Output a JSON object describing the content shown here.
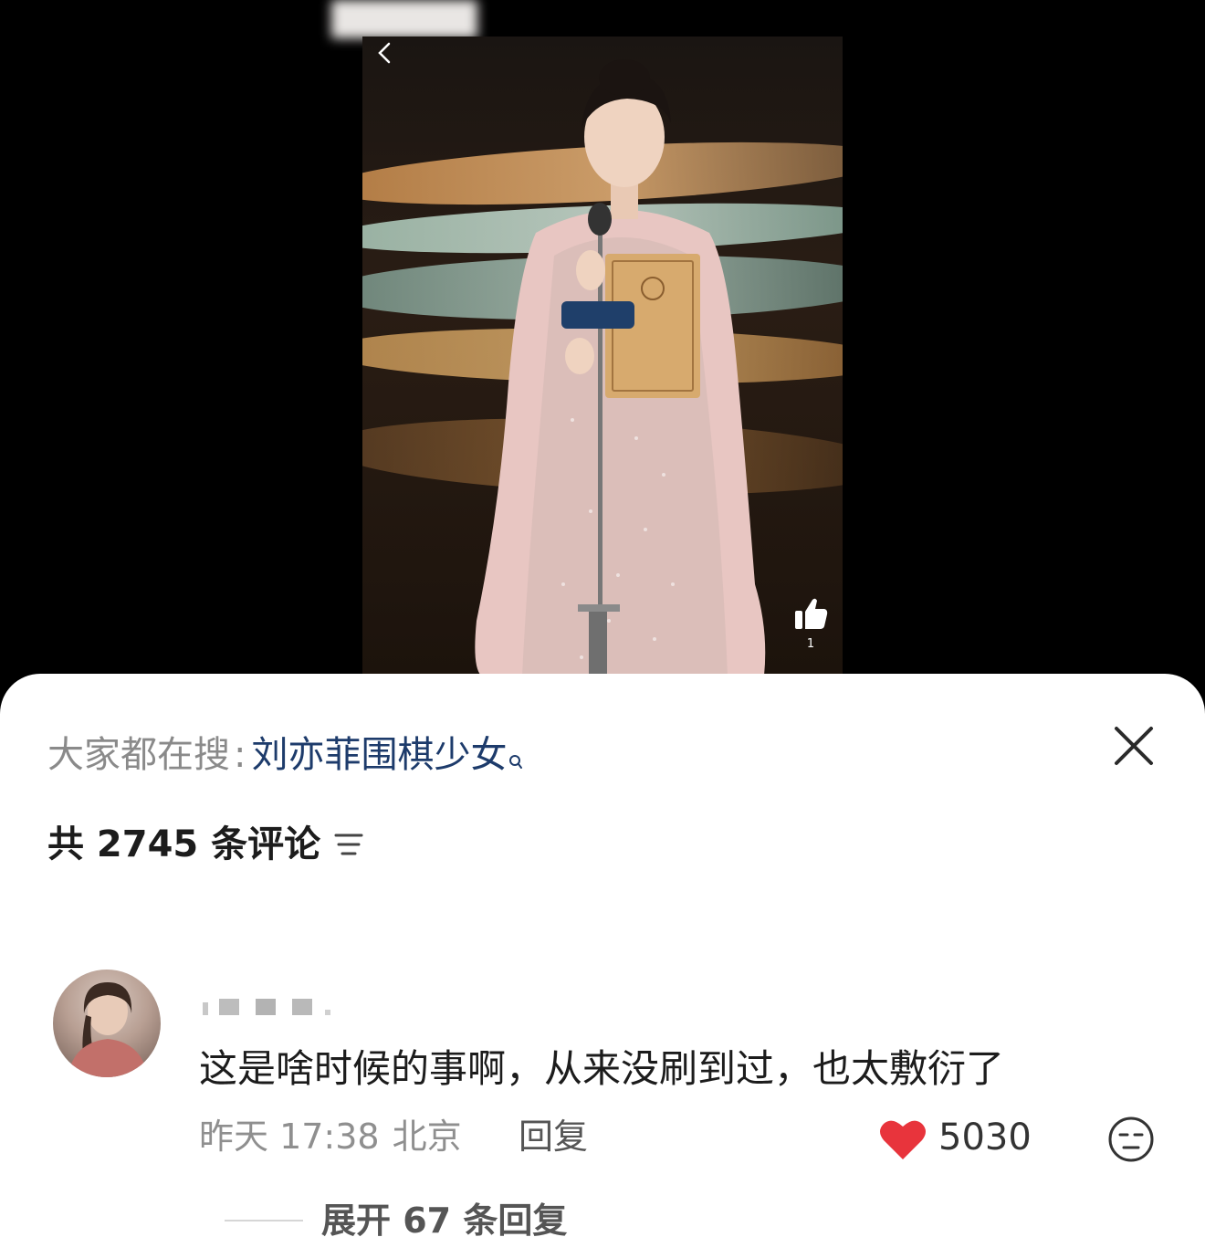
{
  "video": {
    "like_count": "1",
    "icons": {
      "back": "chevron-left-icon",
      "like": "thumbs-up-icon"
    }
  },
  "sheet": {
    "search_prefix": "大家都在搜",
    "search_separator": ":",
    "search_term": "刘亦菲围棋少女",
    "comment_count_text": "共 2745 条评论",
    "icons": {
      "close": "close-icon",
      "sort": "sort-lines-icon",
      "search": "search-icon"
    },
    "comment": {
      "text": "这是啥时候的事啊，从来没刷到过，也太敷衍了",
      "date": "昨天 17:38",
      "location": "北京",
      "reply_label": "回复",
      "likes": "5030",
      "expand_label": "展开 67 条回复",
      "heart_color": "#e8343c"
    }
  },
  "colors": {
    "search_term": "#1d3b6b",
    "muted": "#8a8a8a",
    "text": "#1c1c1c",
    "background_top": "#000000",
    "sheet": "#ffffff"
  }
}
